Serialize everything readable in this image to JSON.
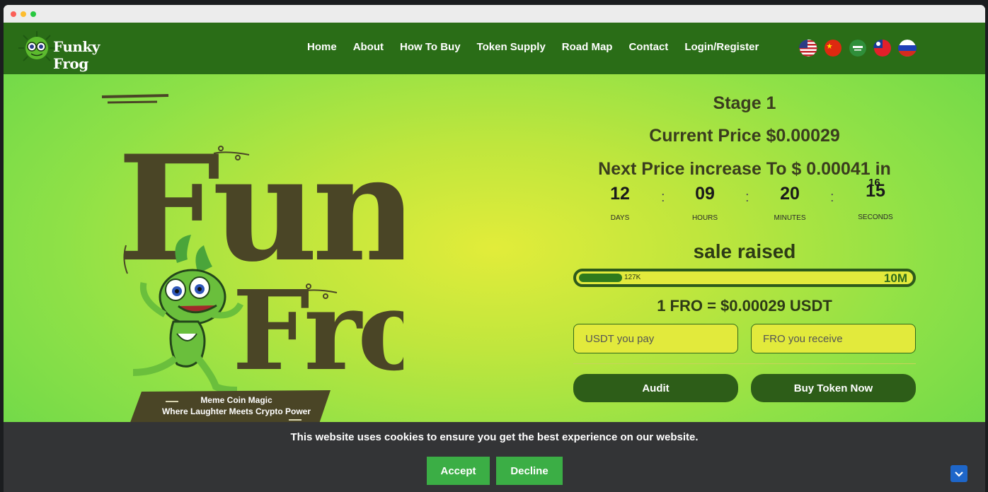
{
  "brand": {
    "name": "Funky Frog"
  },
  "nav": {
    "items": [
      "Home",
      "About",
      "How To Buy",
      "Token Supply",
      "Road Map",
      "Contact",
      "Login/Register"
    ]
  },
  "languages": [
    {
      "icon": "us-flag-icon"
    },
    {
      "icon": "china-flag-icon"
    },
    {
      "icon": "saudi-flag-icon"
    },
    {
      "icon": "taiwan-flag-icon"
    },
    {
      "icon": "russia-flag-icon"
    }
  ],
  "hero": {
    "title_line1": "Funky",
    "title_line2": "Frog",
    "banner_line1": "Meme Coin Magic",
    "banner_line2": "Where Laughter Meets Crypto Power"
  },
  "presale": {
    "stage": "Stage 1",
    "current_price": "Current Price $0.00029",
    "next_price": "Next Price increase To $ 0.00041 in",
    "countdown": {
      "days": "12",
      "hours": "09",
      "minutes": "20",
      "seconds": "15",
      "seconds_prev": "16",
      "days_label": "DAYS",
      "hours_label": "HOURS",
      "minutes_label": "MINUTES",
      "seconds_label": "SECONDS",
      "separator": ":"
    },
    "sale_raised_label": "sale raised",
    "raised": "127K",
    "target": "10M",
    "progress_fraction": 0.13,
    "rate": "1 FRO = $0.00029 USDT",
    "pay_placeholder": "USDT you pay",
    "receive_placeholder": "FRO you receive",
    "audit_label": "Audit",
    "buy_label": "Buy Token Now"
  },
  "cookie": {
    "message": "This website uses cookies to ensure you get the best experience on our website.",
    "accept_label": "Accept",
    "decline_label": "Decline"
  },
  "colors": {
    "nav_bg": "#2a6d17",
    "accent_yellow": "#e2ea3c",
    "button_green": "#2d5d18",
    "cookie_bg": "#333436",
    "cookie_button": "#3bae45",
    "title_brown": "#4a4526"
  }
}
